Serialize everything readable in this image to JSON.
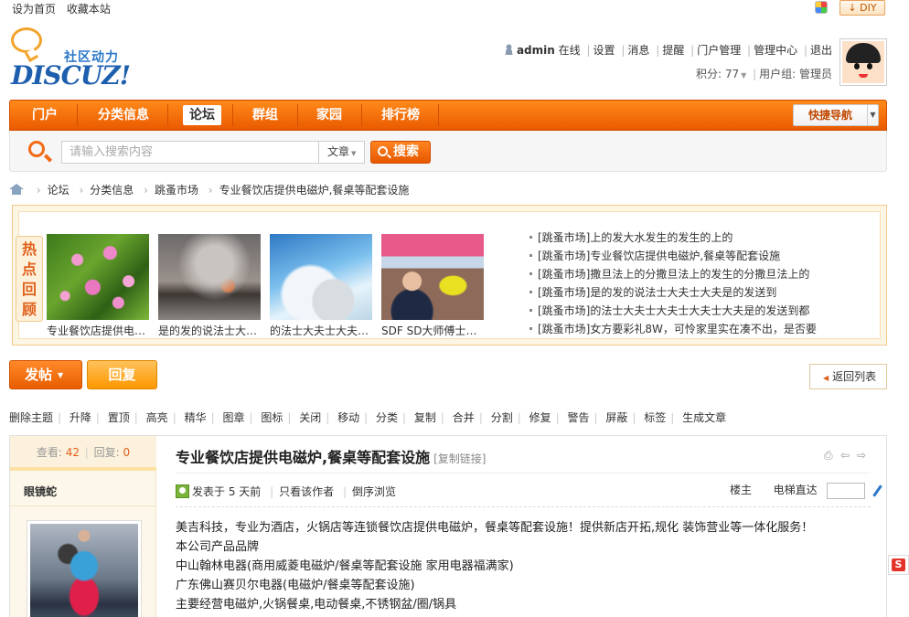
{
  "topbar": {
    "set_home": "设为首页",
    "bookmark": "收藏本站",
    "diy": "↓ DIY"
  },
  "logo": {
    "cn": "社区动力",
    "en": "DISCUZ!"
  },
  "user": {
    "name": "admin",
    "online": "在线",
    "links": [
      "设置",
      "消息",
      "提醒",
      "门户管理",
      "管理中心",
      "退出"
    ],
    "points": "积分: 77",
    "group": "用户组: 管理员"
  },
  "nav": {
    "items": [
      "门户",
      "分类信息",
      "论坛",
      "群组",
      "家园",
      "排行榜"
    ],
    "active_index": 2,
    "quick": "快捷导航"
  },
  "search": {
    "placeholder": "请输入搜索内容",
    "type": "文章",
    "button": "搜索"
  },
  "breadcrumb": [
    "论坛",
    "分类信息",
    "跳蚤市场",
    "专业餐饮店提供电磁炉,餐桌等配套设施"
  ],
  "hot": {
    "tag": [
      "热",
      "点",
      "回",
      "顾"
    ],
    "thumbs": [
      {
        "caption": "专业餐饮店提供电磁炉"
      },
      {
        "caption": "是的发的说法士大夫士"
      },
      {
        "caption": "的法士大夫士大夫士大"
      },
      {
        "caption": "SDF SD大师傅士大夫"
      }
    ],
    "list": [
      "[跳蚤市场]上的发大水发生的发生的上的",
      "[跳蚤市场]专业餐饮店提供电磁炉,餐桌等配套设施",
      "[跳蚤市场]撒旦法上的分撒旦法上的发生的分撒旦法上的",
      "[跳蚤市场]是的发的说法士大夫士大夫是的发送到",
      "[跳蚤市场]的法士大夫士大夫士大夫士大夫是的发送到都",
      "[跳蚤市场]女方要彩礼8W，可怜家里实在凑不出，是否要"
    ]
  },
  "actions": {
    "post": "发帖",
    "reply": "回复",
    "back": "返回列表"
  },
  "mod_actions": [
    "删除主题",
    "升降",
    "置顶",
    "高亮",
    "精华",
    "图章",
    "图标",
    "关闭",
    "移动",
    "分类",
    "复制",
    "合并",
    "分割",
    "修复",
    "警告",
    "屏蔽",
    "标签",
    "生成文章"
  ],
  "post": {
    "views_label": "查看:",
    "views": "42",
    "replies_label": "回复:",
    "replies": "0",
    "author": "眼镜蛇",
    "title": "专业餐饮店提供电磁炉,餐桌等配套设施",
    "copy_link": "[复制链接]",
    "posted": "发表于 5 天前",
    "only_author": "只看该作者",
    "reverse": "倒序浏览",
    "floor": "楼主",
    "elevator": "电梯直达",
    "body": [
      "美吉科技，专业为酒店，火锅店等连锁餐饮店提供电磁炉，餐桌等配套设施！提供新店开拓,规化 装饰营业等一体化服务！",
      "本公司产品品牌",
      "中山翰林电器(商用威菱电磁炉/餐桌等配套设施 家用电器福满家)",
      "广东佛山赛贝尔电器(电磁炉/餐桌等配套设施)",
      "主要经营电磁炉,火锅餐桌,电动餐桌,不锈钢盆/圈/锅具"
    ]
  }
}
